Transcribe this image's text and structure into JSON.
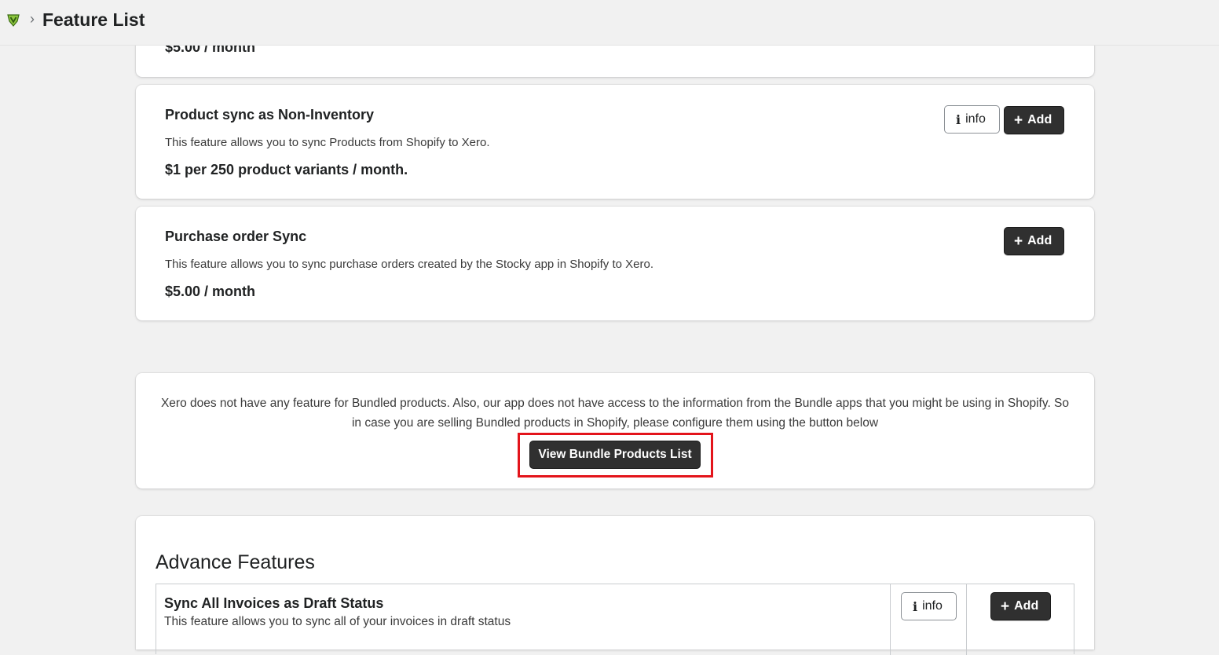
{
  "header": {
    "breadcrumb_separator": "›",
    "title": "Feature List"
  },
  "features": {
    "top_card": {
      "price": "$5.00 / month"
    },
    "items": [
      {
        "title": "Product sync as Non-Inventory",
        "description": "This feature allows you to sync Products from Shopify to Xero.",
        "price": "$1 per 250 product variants / month.",
        "info_label": "info",
        "add_label": "Add"
      },
      {
        "title": "Purchase order Sync",
        "description": "This feature allows you to sync purchase orders created by the Stocky app in Shopify to Xero.",
        "price": "$5.00 / month",
        "add_label": "Add"
      }
    ]
  },
  "bundle": {
    "text": "Xero does not have any feature for Bundled products. Also, our app does not have access to the information from the Bundle apps that you might be using in Shopify. So in case you are selling Bundled products in Shopify, please configure them using the button below",
    "button_label": "View Bundle Products List"
  },
  "advance": {
    "heading": "Advance Features",
    "rows": [
      {
        "title": "Sync All Invoices as Draft Status",
        "description": "This feature allows you to sync all of your invoices in draft status",
        "info_label": "info",
        "add_label": "Add"
      }
    ]
  },
  "icons": {
    "logo": "app-logo-icon",
    "info": "info-icon",
    "add": "plus-icon"
  },
  "colors": {
    "background": "#f1f1f1",
    "primary_button": "#303030",
    "highlight": "#e3141b",
    "logo_green": "#8dc63f"
  }
}
